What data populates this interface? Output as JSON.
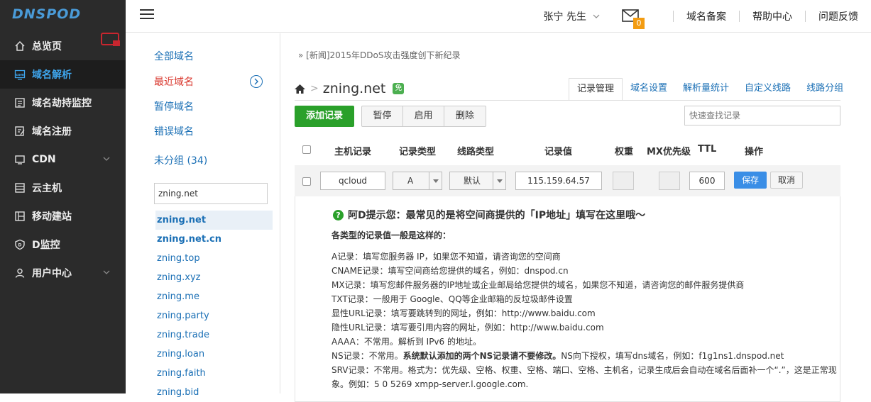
{
  "logo": "DNSPOD",
  "sidebar": {
    "items": [
      {
        "label": "总览页",
        "icon": "home-icon"
      },
      {
        "label": "域名解析",
        "icon": "dns-icon",
        "active": true
      },
      {
        "label": "域名劫持监控",
        "icon": "monitor-list-icon"
      },
      {
        "label": "域名注册",
        "icon": "register-icon"
      },
      {
        "label": "CDN",
        "icon": "cdn-icon",
        "expandable": true
      },
      {
        "label": "云主机",
        "icon": "server-icon"
      },
      {
        "label": "移动建站",
        "icon": "mobile-icon"
      },
      {
        "label": "D监控",
        "icon": "shield-icon"
      },
      {
        "label": "用户中心",
        "icon": "user-icon",
        "expandable": true
      }
    ]
  },
  "header": {
    "user": "张宁 先生",
    "mail_count": "0",
    "links": [
      "域名备案",
      "帮助中心",
      "问题反馈"
    ]
  },
  "domain_panel": {
    "categories": [
      "全部域名",
      "最近域名",
      "暂停域名",
      "错误域名",
      "未分组 (34)"
    ],
    "search_value": "zning.net",
    "domains": [
      "zning.net",
      "zning.net.cn",
      "zning.top",
      "zning.xyz",
      "zning.me",
      "zning.party",
      "zning.trade",
      "zning.loan",
      "zning.faith",
      "zning.bid"
    ]
  },
  "main": {
    "news": "» [新闻]2015年DDoS攻击强度创下新纪录",
    "domain": "zning.net",
    "free_badge": "免",
    "tabs": [
      "记录管理",
      "域名设置",
      "解析量统计",
      "自定义线路",
      "线路分组"
    ],
    "toolbar": {
      "add": "添加记录",
      "pause": "暂停",
      "enable": "启用",
      "delete": "删除"
    },
    "quick_search_placeholder": "快速查找记录",
    "columns": [
      "主机记录",
      "记录类型",
      "线路类型",
      "记录值",
      "权重",
      "MX优先级",
      "TTL",
      "操作"
    ],
    "edit_row": {
      "host": "qcloud",
      "type": "A",
      "line": "默认",
      "value": "115.159.64.57",
      "ttl": "600",
      "save": "保存",
      "cancel": "取消"
    },
    "tip": {
      "title": "阿D提示您：最常见的是将空间商提供的「IP地址」填写在这里哦～",
      "subtitle": "各类型的记录值一般是这样的：",
      "lines": [
        "A记录：填写您服务器 IP，如果您不知道，请咨询您的空间商",
        "CNAME记录：填写空间商给您提供的域名，例如：dnspod.cn",
        "MX记录：填写您邮件服务器的IP地址或企业邮局给您提供的域名，如果您不知道，请咨询您的邮件服务提供商",
        "TXT记录：一般用于 Google、QQ等企业邮箱的反垃圾邮件设置",
        "显性URL记录：填写要跳转到的网址，例如：http://www.baidu.com",
        "隐性URL记录：填写要引用内容的网址，例如：http://www.baidu.com",
        "AAAA：不常用。解析到 IPv6 的地址。"
      ],
      "ns_prefix": "NS记录：不常用。",
      "ns_bold": "系统默认添加的两个NS记录请不要修改。",
      "ns_suffix": "NS向下授权，填写dns域名，例如：f1g1ns1.dnspod.net",
      "srv_line1": "SRV记录：不常用。格式为：优先级、空格、权重、空格、端口、空格、主机名，记录生成后会自动在域名后面补一个“.”，这是正常现",
      "srv_line2": "象。例如：5 0 5269 xmpp-server.l.google.com."
    }
  }
}
